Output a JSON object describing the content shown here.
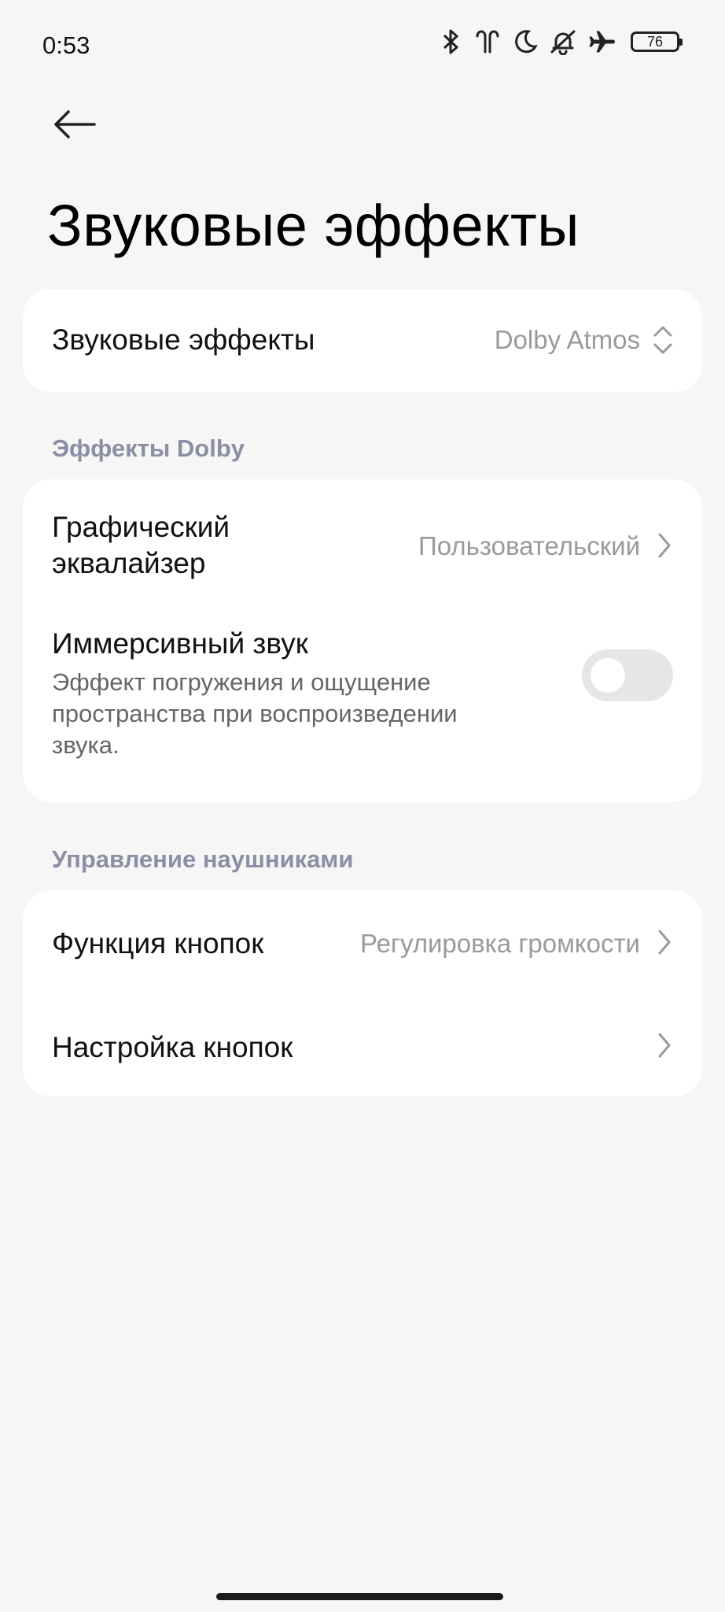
{
  "status_bar": {
    "time": "0:53",
    "battery": "76",
    "icons": [
      "bluetooth-icon",
      "earbuds-icon",
      "moon-icon",
      "bell-off-icon",
      "airplane-icon",
      "battery-icon"
    ]
  },
  "header": {
    "back_icon": "arrow-left-icon",
    "title": "Звуковые эффекты"
  },
  "sound_effects": {
    "label": "Звуковые эффекты",
    "value": "Dolby Atmos"
  },
  "dolby_section": {
    "header": "Эффекты Dolby",
    "equalizer": {
      "label_line1": "Графический",
      "label_line2": "эквалайзер",
      "value": "Пользовательский"
    },
    "immersive": {
      "label": "Иммерсивный звук",
      "desc_line1": "Эффект погружения и ощущение",
      "desc_line2": "пространства при воспроизведении",
      "desc_line3": "звука.",
      "enabled": false
    }
  },
  "headphones_section": {
    "header": "Управление наушниками",
    "button_function": {
      "label": "Функция кнопок",
      "value": "Регулировка громкости"
    },
    "button_settings": {
      "label": "Настройка кнопок"
    }
  }
}
